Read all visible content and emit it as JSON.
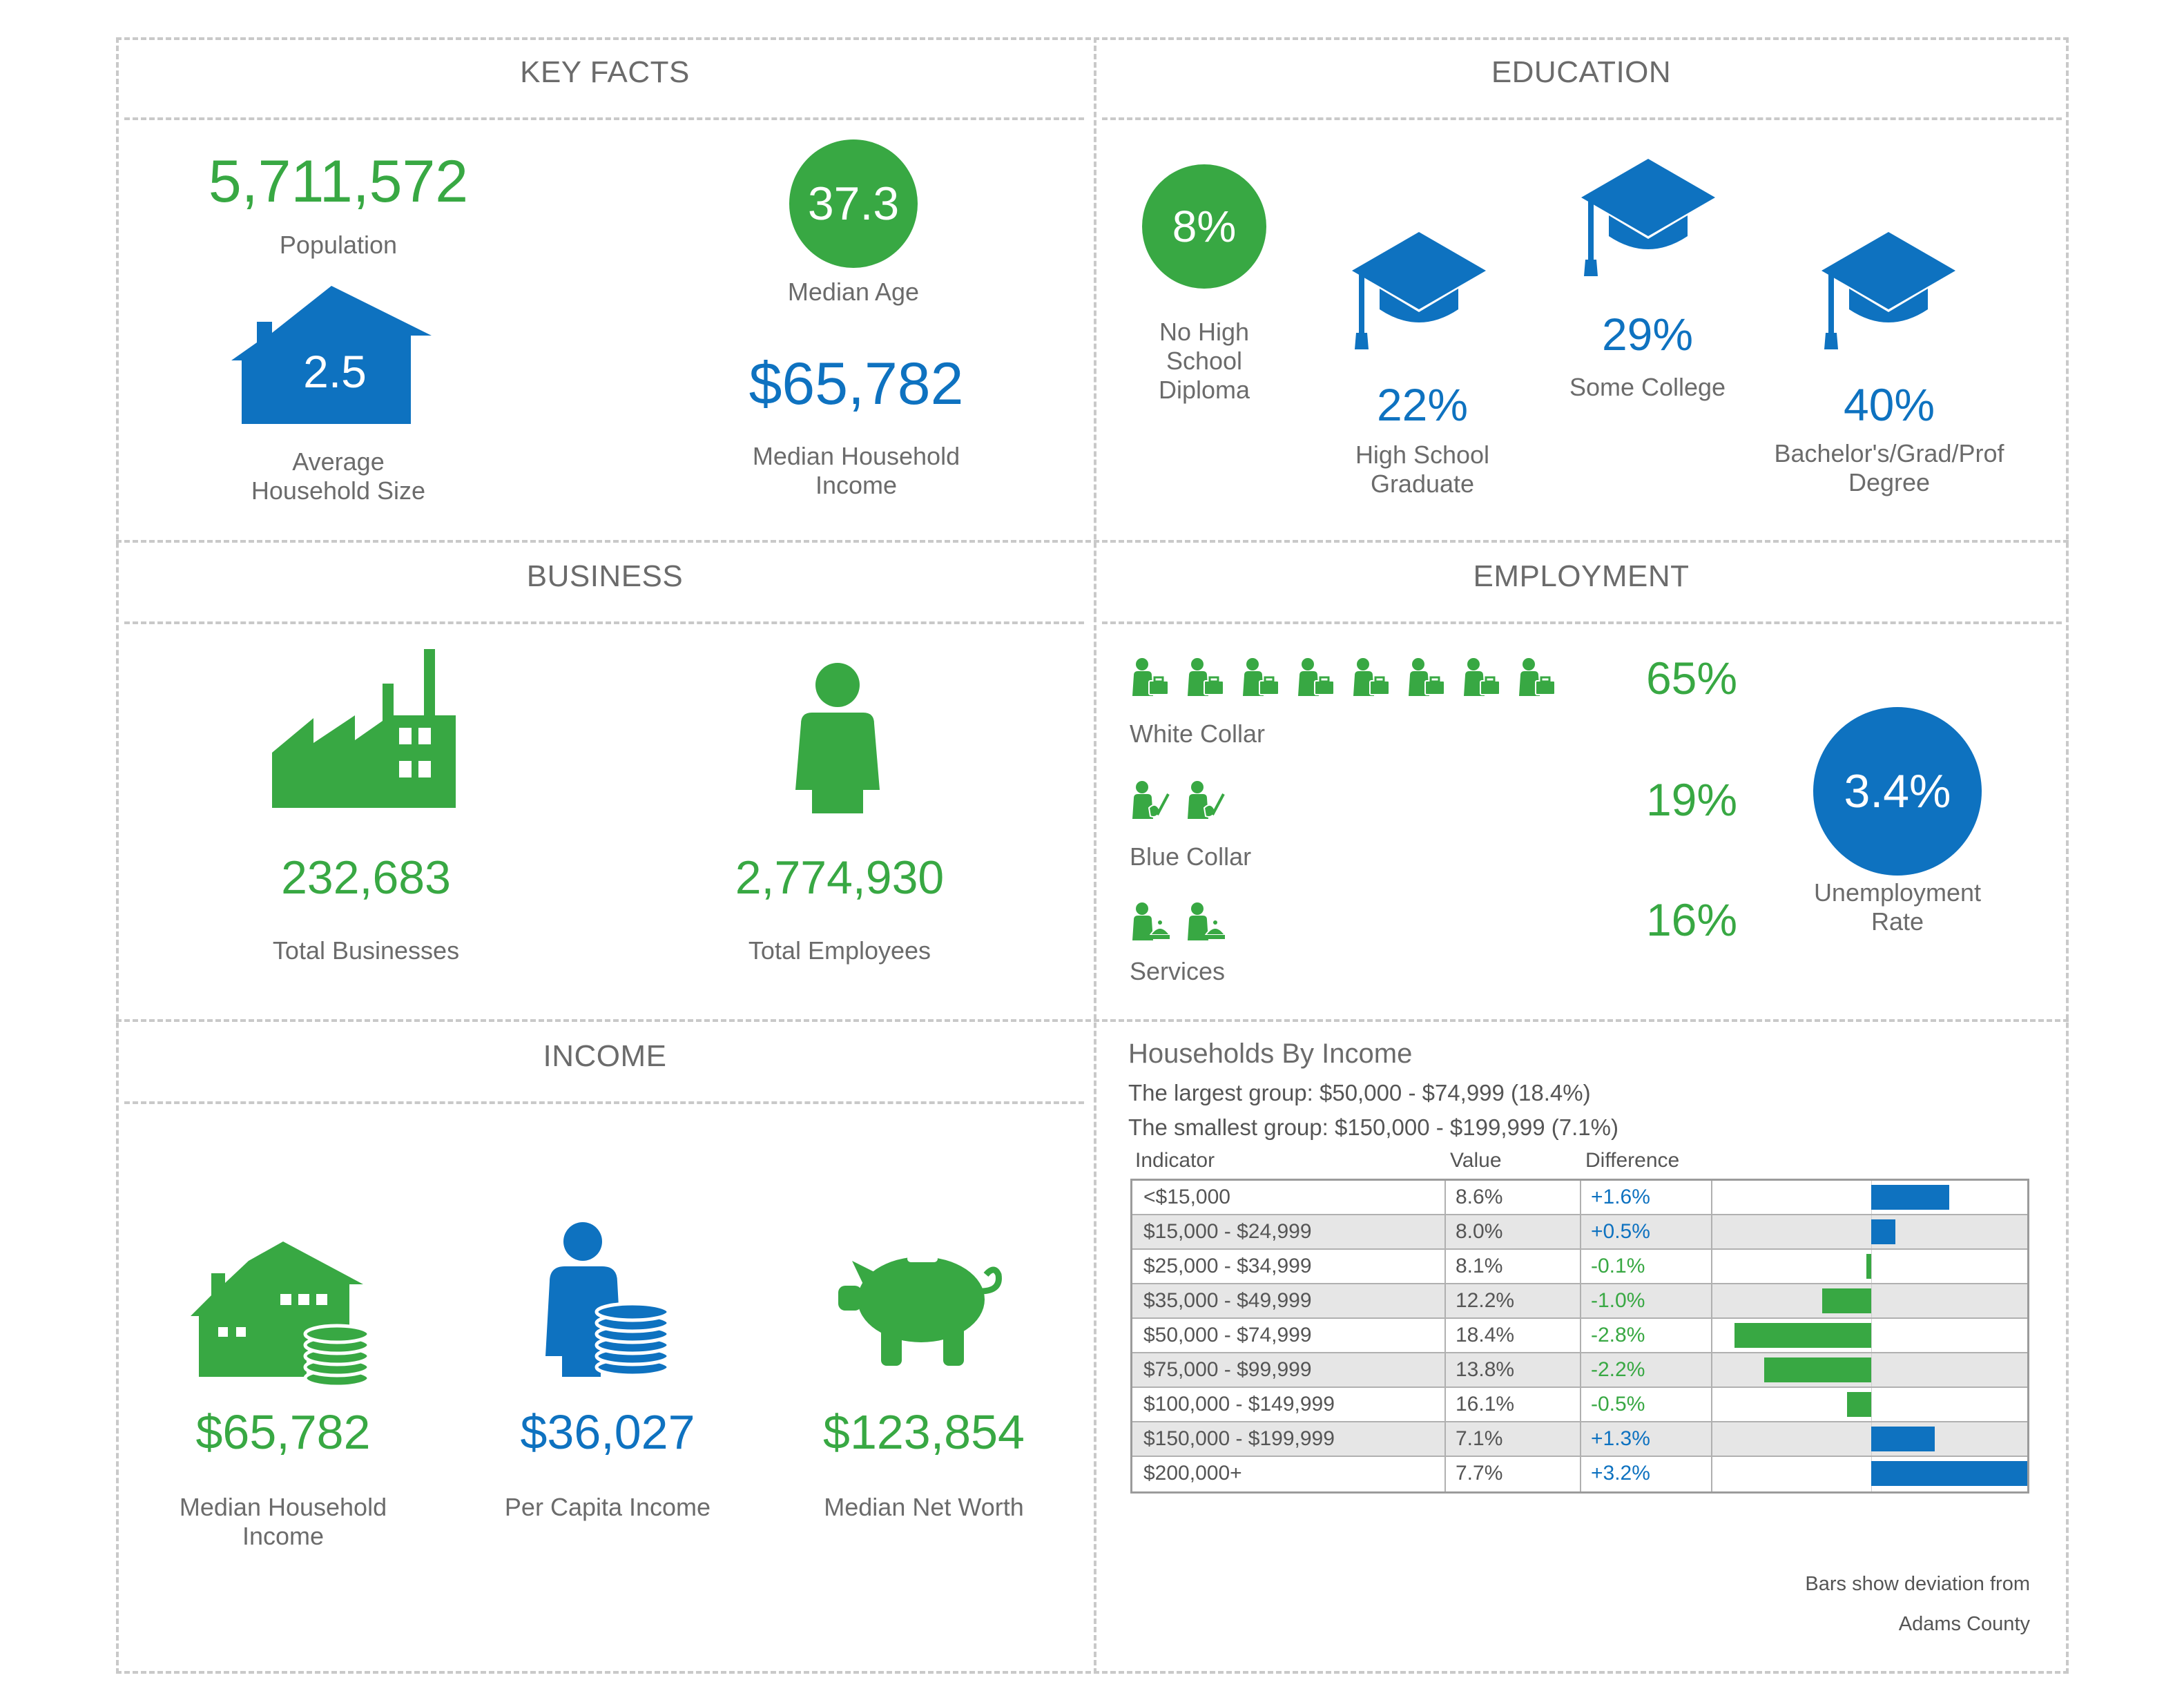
{
  "sections": {
    "key_facts": "KEY FACTS",
    "education": "EDUCATION",
    "business": "BUSINESS",
    "employment": "EMPLOYMENT",
    "income": "INCOME"
  },
  "key_facts": {
    "population_value": "5,711,572",
    "population_label": "Population",
    "median_age_value": "37.3",
    "median_age_label": "Median Age",
    "household_size_value": "2.5",
    "household_size_label_1": "Average",
    "household_size_label_2": "Household Size",
    "median_income_value": "$65,782",
    "median_income_label_1": "Median Household",
    "median_income_label_2": "Income"
  },
  "education": {
    "no_hs_value": "8%",
    "no_hs_label": [
      "No High",
      "School",
      "Diploma"
    ],
    "hs_value": "22%",
    "hs_label": [
      "High School",
      "Graduate"
    ],
    "college_value": "29%",
    "college_label": "Some College",
    "bachelor_value": "40%",
    "bachelor_label": [
      "Bachelor's/Grad/Prof",
      "Degree"
    ]
  },
  "business": {
    "total_businesses_value": "232,683",
    "total_businesses_label": "Total Businesses",
    "total_employees_value": "2,774,930",
    "total_employees_label": "Total Employees"
  },
  "employment": {
    "white_collar_value": "65%",
    "white_collar_label": "White Collar",
    "blue_collar_value": "19%",
    "blue_collar_label": "Blue Collar",
    "services_value": "16%",
    "services_label": "Services",
    "unemployment_value": "3.4%",
    "unemployment_label_1": "Unemployment",
    "unemployment_label_2": "Rate"
  },
  "income": {
    "median_household_value": "$65,782",
    "median_household_label_1": "Median Household",
    "median_household_label_2": "Income",
    "per_capita_value": "$36,027",
    "per_capita_label": "Per Capita Income",
    "net_worth_value": "$123,854",
    "net_worth_label": "Median Net Worth"
  },
  "households_by_income": {
    "title": "Households By Income",
    "largest": "The largest group: $50,000 - $74,999 (18.4%)",
    "smallest": "The smallest group: $150,000 - $199,999 (7.1%)",
    "headers": [
      "Indicator",
      "Value",
      "Difference"
    ],
    "rows": [
      {
        "indicator": "<$15,000",
        "value": "8.6%",
        "difference": "+1.6%"
      },
      {
        "indicator": "$15,000 - $24,999",
        "value": "8.0%",
        "difference": "+0.5%"
      },
      {
        "indicator": "$25,000 - $34,999",
        "value": "8.1%",
        "difference": "-0.1%"
      },
      {
        "indicator": "$35,000 - $49,999",
        "value": "12.2%",
        "difference": "-1.0%"
      },
      {
        "indicator": "$50,000 - $74,999",
        "value": "18.4%",
        "difference": "-2.8%"
      },
      {
        "indicator": "$75,000 - $99,999",
        "value": "13.8%",
        "difference": "-2.2%"
      },
      {
        "indicator": "$100,000 - $149,999",
        "value": "16.1%",
        "difference": "-0.5%"
      },
      {
        "indicator": "$150,000 - $199,999",
        "value": "7.1%",
        "difference": "+1.3%"
      },
      {
        "indicator": "$200,000+",
        "value": "7.7%",
        "difference": "+3.2%"
      }
    ],
    "deviations": [
      1.6,
      0.5,
      -0.1,
      -1.0,
      -2.8,
      -2.2,
      -0.5,
      1.3,
      3.2
    ],
    "footnote_1": "Bars show deviation from",
    "footnote_2": "Adams County",
    "colors": {
      "positive": "#0e72c0",
      "negative": "#38a843"
    }
  },
  "colors": {
    "green": "#38a843",
    "blue": "#0e72c0",
    "text": "#6b6b6b"
  }
}
